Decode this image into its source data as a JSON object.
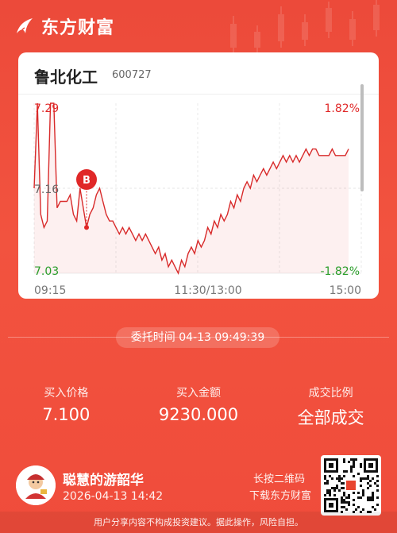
{
  "brand": {
    "name": "东方财富"
  },
  "stock": {
    "name": "鲁北化工",
    "code": "600727"
  },
  "chart_data": {
    "type": "line",
    "title": "",
    "x_ticks": [
      "09:15",
      "11:30/13:00",
      "15:00"
    ],
    "y_ticks_left": [
      "7.29",
      "7.16",
      "7.03"
    ],
    "y_ticks_right": [
      "1.82%",
      "-1.82%"
    ],
    "ylim": [
      7.03,
      7.29
    ],
    "reference_price": 7.16,
    "marker": {
      "label": "B",
      "price": 7.1,
      "time": "09:49"
    },
    "series": [
      {
        "values": [
          7.16,
          7.29,
          7.12,
          7.1,
          7.11,
          7.29,
          7.29,
          7.13,
          7.14,
          7.14,
          7.14,
          7.15,
          7.12,
          7.11,
          7.16,
          7.13,
          7.1,
          7.12,
          7.13,
          7.15,
          7.16,
          7.14,
          7.12,
          7.11,
          7.11,
          7.1,
          7.09,
          7.1,
          7.09,
          7.1,
          7.09,
          7.08,
          7.09,
          7.08,
          7.09,
          7.08,
          7.07,
          7.06,
          7.07,
          7.05,
          7.06,
          7.04,
          7.05,
          7.04,
          7.03,
          7.05,
          7.04,
          7.06,
          7.07,
          7.06,
          7.08,
          7.07,
          7.08,
          7.1,
          7.09,
          7.11,
          7.1,
          7.12,
          7.11,
          7.12,
          7.14,
          7.13,
          7.15,
          7.14,
          7.16,
          7.17,
          7.16,
          7.18,
          7.17,
          7.18,
          7.19,
          7.18,
          7.19,
          7.2,
          7.19,
          7.2,
          7.21,
          7.2,
          7.21,
          7.2,
          7.21,
          7.2,
          7.21,
          7.22,
          7.21,
          7.22,
          7.22,
          7.21,
          7.21,
          7.21,
          7.21,
          7.22,
          7.21,
          7.21,
          7.21,
          7.21,
          7.22
        ]
      }
    ]
  },
  "order": {
    "time_label": "委托时间 04-13 09:49:39"
  },
  "stats": [
    {
      "label": "买入价格",
      "value": "7.100"
    },
    {
      "label": "买入金额",
      "value": "9230.000"
    },
    {
      "label": "成交比例",
      "value": "全部成交"
    }
  ],
  "user": {
    "name": "聪慧的游韶华",
    "time": "2026-04-13 14:42"
  },
  "qr_hint": {
    "line1": "长按二维码",
    "line2": "下载东方财富"
  },
  "disclaimer": "用户分享内容不构成投资建议。据此操作，风险自担。",
  "colors": {
    "background": "#ef4f3c",
    "up": "#e02828",
    "down": "#2a9d2a"
  }
}
